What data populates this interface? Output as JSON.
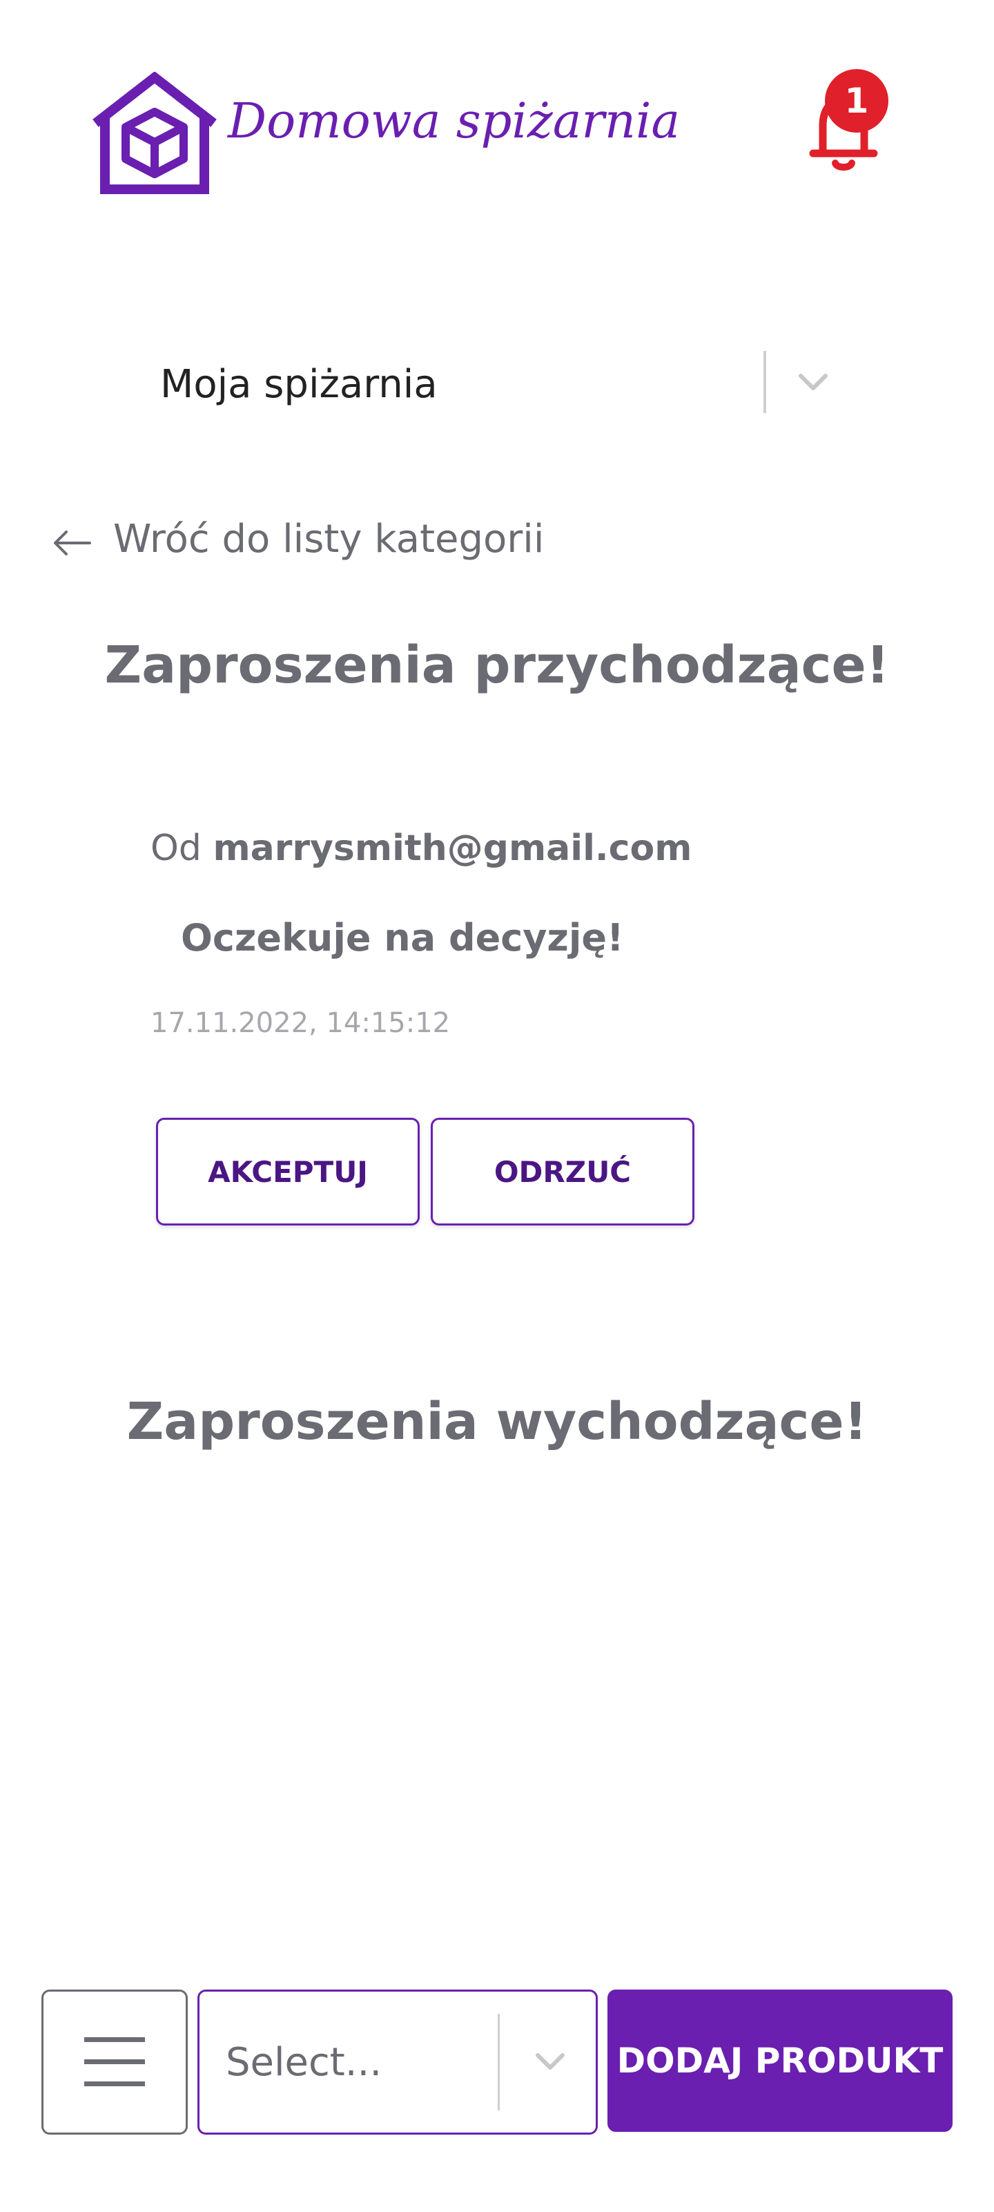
{
  "header": {
    "app_title": "Domowa spiżarnia",
    "notification_count": "1",
    "logo_icon": "house-box-icon",
    "bell_icon": "bell-icon"
  },
  "pantry_select": {
    "value": "Moja spiżarnia"
  },
  "back_link": {
    "label": "Wróć do listy kategorii"
  },
  "incoming": {
    "title": "Zaproszenia przychodzące!",
    "items": [
      {
        "from_prefix": "Od",
        "from_email": "marrysmith@gmail.com",
        "status": "Oczekuje na decyzję!",
        "date": "17.11.2022, 14:15:12",
        "accept_label": "AKCEPTUJ",
        "reject_label": "ODRZUĆ"
      }
    ]
  },
  "outgoing": {
    "title": "Zaproszenia wychodzące!"
  },
  "bottom_bar": {
    "select_placeholder": "Select...",
    "add_label": "DODAJ PRODUKT"
  },
  "colors": {
    "brand": "#6a1fb0",
    "badge": "#e0202a",
    "text": "#6b6b73",
    "muted": "#a6a6ad"
  }
}
